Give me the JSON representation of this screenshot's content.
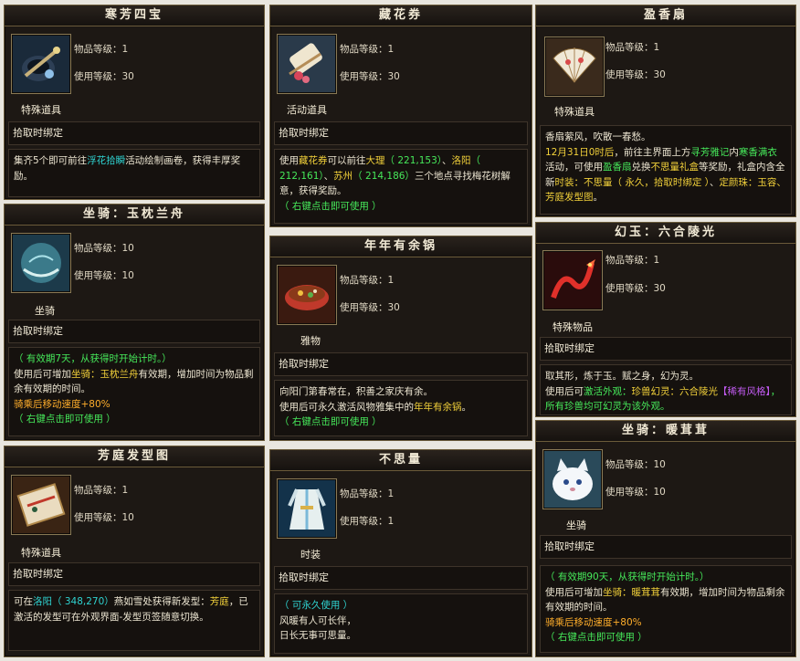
{
  "labels": {
    "item_level": "物品等级：",
    "use_level": "使用等级："
  },
  "cards": [
    {
      "title": "寒芳四宝",
      "item_level": "1",
      "use_level": "30",
      "category": "特殊道具",
      "bind": "拾取时绑定",
      "desc": [
        [
          {
            "t": "集齐5个即可前往"
          },
          {
            "t": "浮花拾瞬",
            "c": "t"
          },
          {
            "t": "活动绘制画卷，获得丰厚奖励。"
          }
        ]
      ]
    },
    {
      "title": "藏花券",
      "item_level": "1",
      "use_level": "30",
      "category": "活动道具",
      "bind": "拾取时绑定",
      "desc": [
        [
          {
            "t": "使用"
          },
          {
            "t": "藏花券",
            "c": "y"
          },
          {
            "t": "可以前往"
          },
          {
            "t": "大理",
            "c": "y"
          },
          {
            "t": "（ 221,153）",
            "c": "g"
          },
          {
            "t": "、"
          },
          {
            "t": "洛阳",
            "c": "y"
          },
          {
            "t": "（ 212,161）",
            "c": "g"
          },
          {
            "t": "、"
          },
          {
            "t": "苏州",
            "c": "y"
          },
          {
            "t": "（ 214,186）",
            "c": "g"
          },
          {
            "t": "三个地点寻找梅花树解意，获得奖励。"
          }
        ],
        [
          {
            "t": "（ 右键点击即可使用 ）",
            "c": "g"
          }
        ]
      ]
    },
    {
      "title": "盈香扇",
      "item_level": "1",
      "use_level": "30",
      "category": "特殊道具",
      "bind": "拾取时绑定",
      "desc": [
        [
          {
            "t": "香扇萦风，吹散一春愁。"
          }
        ],
        [
          {
            "t": "12月31日0时后",
            "c": "y"
          },
          {
            "t": "，前往主界面上方"
          },
          {
            "t": "寻芳雅记",
            "c": "g"
          },
          {
            "t": "内"
          },
          {
            "t": "寒香满衣",
            "c": "g"
          },
          {
            "t": "活动，可使用"
          },
          {
            "t": "盈香扇",
            "c": "g"
          },
          {
            "t": "兑换"
          },
          {
            "t": "不思量礼盒",
            "c": "y"
          },
          {
            "t": "等奖励，礼盒内含全新"
          },
          {
            "t": "时装：不思量（ 永久，拾取时绑定 ）",
            "c": "y"
          },
          {
            "t": "、"
          },
          {
            "t": "定颜珠：玉容、芳庭发型图",
            "c": "y"
          },
          {
            "t": "。"
          }
        ]
      ]
    },
    {
      "title": "坐骑：玉枕兰舟",
      "item_level": "10",
      "use_level": "10",
      "category": "坐骑",
      "bind": "拾取时绑定",
      "desc": [
        [
          {
            "t": "（ 有效期7天，从获得时开始计时。）",
            "c": "g"
          }
        ],
        [
          {
            "t": "使用后可增加"
          },
          {
            "t": "坐骑：玉枕兰舟",
            "c": "y"
          },
          {
            "t": "有效期，增加时间为物品剩余有效期的时间。"
          }
        ],
        [
          {
            "t": "骑乘后移动速度+80%",
            "c": "o"
          }
        ],
        [
          {
            "t": "（ 右键点击即可使用 ）",
            "c": "g"
          }
        ]
      ]
    },
    {
      "title": "年年有余锅",
      "item_level": "1",
      "use_level": "30",
      "category": "雅物",
      "bind": "拾取时绑定",
      "desc": [
        [
          {
            "t": "向阳门第春常在，积善之家庆有余。"
          }
        ],
        [
          {
            "t": "使用后可永久激活风物雅集中的"
          },
          {
            "t": "年年有余锅",
            "c": "y"
          },
          {
            "t": "。"
          }
        ],
        [
          {
            "t": "（ 右键点击即可使用 ）",
            "c": "g"
          }
        ]
      ]
    },
    {
      "title": "幻玉：六合陵光",
      "item_level": "1",
      "use_level": "30",
      "category": "特殊物品",
      "bind": "拾取时绑定",
      "desc": [
        [
          {
            "t": "取其形，炼于玉。赋之身，幻为灵。"
          }
        ],
        [
          {
            "t": "使用后可"
          },
          {
            "t": "激活外观：",
            "c": "g"
          },
          {
            "t": "珍兽幻灵：六合陵光",
            "c": "y"
          },
          {
            "t": "【稀有风格】",
            "c": "p"
          },
          {
            "t": "，所有珍兽均可幻灵为该外观。",
            "c": "g"
          }
        ]
      ]
    },
    {
      "title": "芳庭发型图",
      "item_level": "1",
      "use_level": "10",
      "category": "特殊道具",
      "bind": "拾取时绑定",
      "desc": [
        [
          {
            "t": "可在"
          },
          {
            "t": "洛阳（ 348,270）",
            "c": "t"
          },
          {
            "t": "燕如雪处获得新发型："
          },
          {
            "t": "芳庭",
            "c": "y"
          },
          {
            "t": "，已激活的发型可在外观界面-发型页签随意切换。"
          }
        ]
      ]
    },
    {
      "title": "不思量",
      "item_level": "1",
      "use_level": "1",
      "category": "时装",
      "bind": "拾取时绑定",
      "desc": [
        [
          {
            "t": "（ 可永久使用 ）",
            "c": "t"
          }
        ],
        [
          {
            "t": "风暖有人可长伴，"
          }
        ],
        [
          {
            "t": "日长无事可思量。"
          }
        ]
      ]
    },
    {
      "title": "坐骑：暖茸茸",
      "item_level": "10",
      "use_level": "10",
      "category": "坐骑",
      "bind": "拾取时绑定",
      "desc": [
        [
          {
            "t": "（ 有效期90天，从获得时开始计时。）",
            "c": "g"
          }
        ],
        [
          {
            "t": "使用后可增加"
          },
          {
            "t": "坐骑：暖茸茸",
            "c": "y"
          },
          {
            "t": "有效期，增加时间为物品剩余有效期的时间。"
          }
        ],
        [
          {
            "t": "骑乘后移动速度+80%",
            "c": "o"
          }
        ],
        [
          {
            "t": "（ 右键点击即可使用 ）",
            "c": "g"
          }
        ]
      ]
    }
  ]
}
